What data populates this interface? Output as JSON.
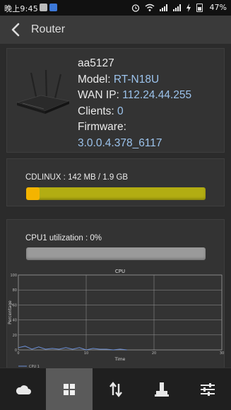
{
  "status_bar": {
    "time": "晚上9:45",
    "battery": "47%"
  },
  "app_bar": {
    "title": "Router",
    "back_icon": "back-arrow-icon"
  },
  "router_info": {
    "name": "aa5127",
    "model_label": "Model:",
    "model": "RT-N18U",
    "wan_label": "WAN IP:",
    "wan_ip": "112.24.44.255",
    "clients_label": "Clients:",
    "clients": "0",
    "firmware_label": "Firmware:",
    "firmware": "3.0.0.4.378_6117"
  },
  "memory": {
    "label": "CDLINUX : 142 MB / 1.9 GB",
    "fraction": 0.073
  },
  "cpu": {
    "label": "CPU1 utilization  : 0%",
    "fraction": 0.0
  },
  "chart_data": {
    "type": "line",
    "title": "CPU",
    "xlabel": "Time",
    "ylabel": "Percentage",
    "xlim": [
      0,
      30
    ],
    "ylim": [
      0,
      100
    ],
    "x_ticks": [
      "0",
      "10",
      "20",
      "30"
    ],
    "y_ticks": [
      "0",
      "20",
      "40",
      "60",
      "80",
      "100"
    ],
    "grid": true,
    "legend": "bottom-left",
    "series": [
      {
        "name": "CPU 1",
        "color": "#6b8fd6",
        "x": [
          0,
          1,
          2,
          3,
          4,
          5,
          6,
          7,
          8,
          9,
          10,
          11,
          12,
          13,
          14,
          15,
          16
        ],
        "y": [
          3,
          5,
          1,
          4,
          1,
          2,
          1,
          3,
          1,
          3,
          0,
          2,
          1,
          1,
          0,
          1,
          0
        ]
      }
    ]
  },
  "bottom_nav": [
    {
      "icon": "cloud-icon",
      "active": false
    },
    {
      "icon": "grid-icon",
      "active": true
    },
    {
      "icon": "transfer-arrows-icon",
      "active": false
    },
    {
      "icon": "joystick-icon",
      "active": false
    },
    {
      "icon": "sliders-icon",
      "active": false
    }
  ]
}
